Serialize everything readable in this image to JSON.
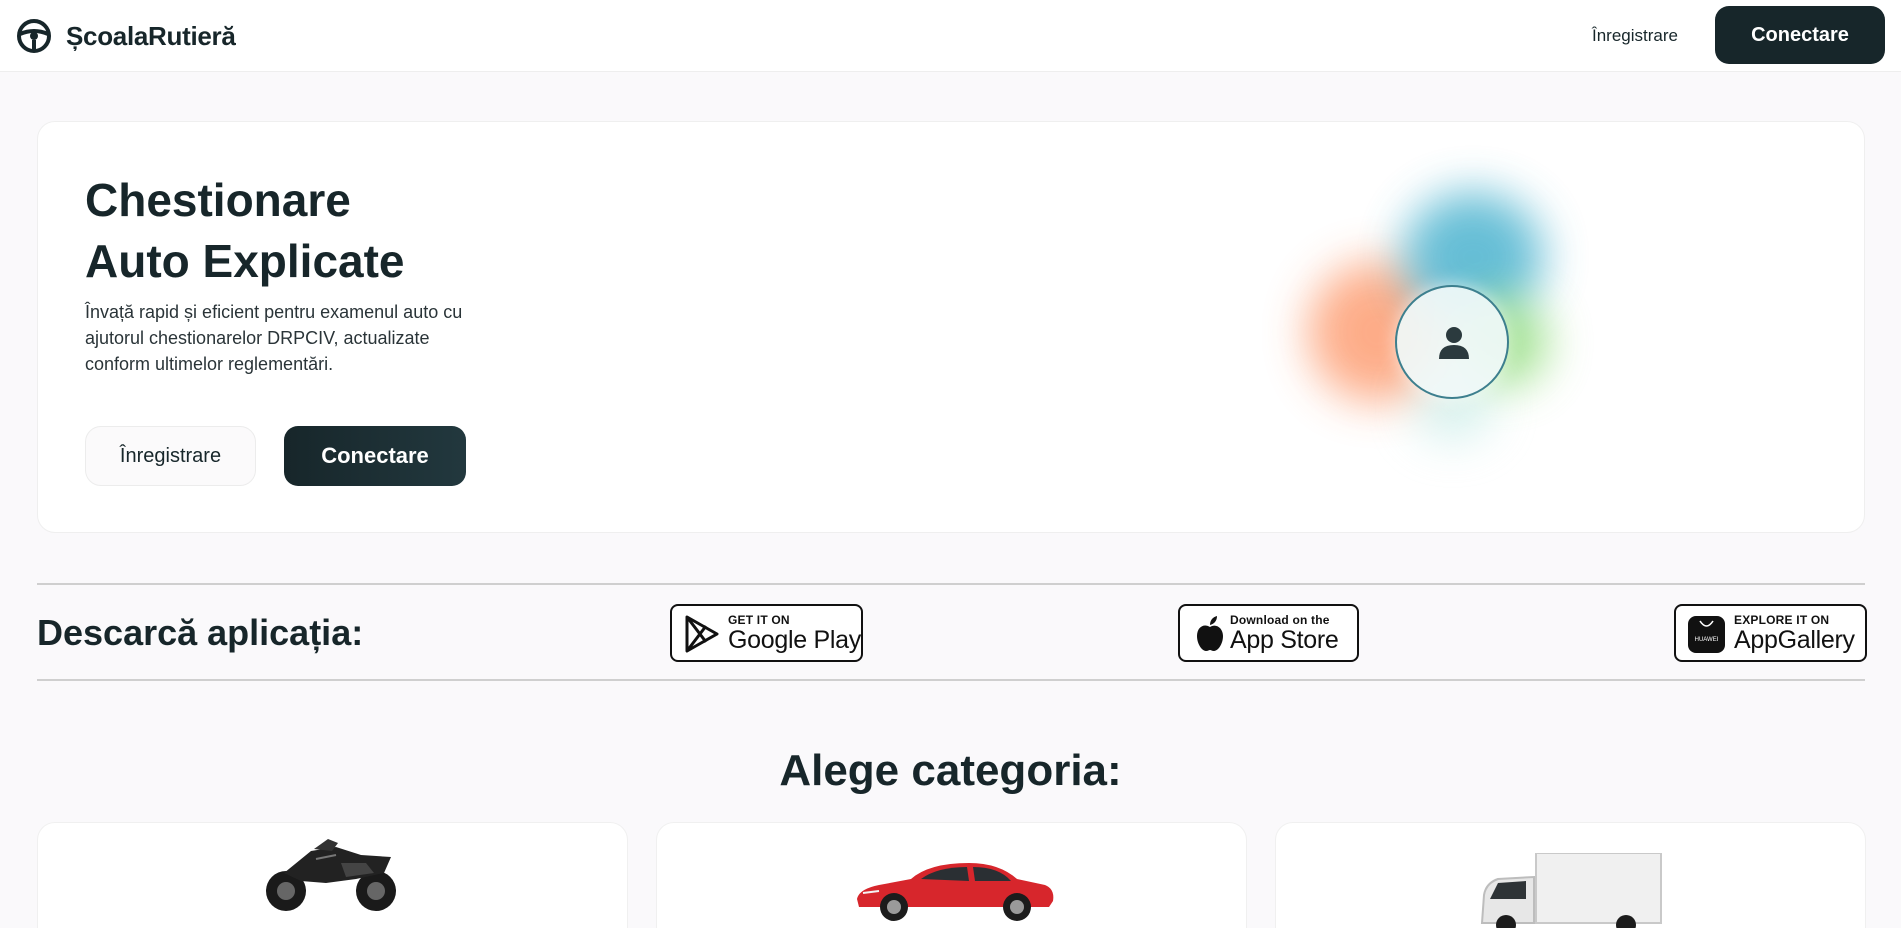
{
  "header": {
    "logo_text": "ȘcoalaRutieră",
    "logo_icon": "steering-wheel-icon",
    "register_label": "Înregistrare",
    "login_label": "Conectare"
  },
  "hero": {
    "title_line1": "Chestionare",
    "title_line2": "Auto Explicate",
    "description": "Învață rapid și eficient pentru examenul auto cu ajutorul chestionarelor DRPCIV, actualizate conform ultimelor reglementări.",
    "register_label": "Înregistrare",
    "login_label": "Conectare",
    "avatar_icon": "user-icon"
  },
  "download": {
    "title": "Descarcă aplicația:",
    "stores": [
      {
        "small": "GET IT ON",
        "big": "Google Play",
        "icon": "google-play-icon"
      },
      {
        "small": "Download on the",
        "big": "App Store",
        "icon": "apple-icon"
      },
      {
        "small": "EXPLORE IT ON",
        "big": "AppGallery",
        "icon": "huawei-appgallery-icon",
        "icon_label": "HUAWEI"
      }
    ]
  },
  "categories": {
    "title": "Alege categoria:",
    "items": [
      {
        "icon": "motorcycle-image"
      },
      {
        "icon": "car-image"
      },
      {
        "icon": "truck-image"
      }
    ]
  },
  "colors": {
    "primary_dark": "#17262a",
    "background": "#faf9fb",
    "card": "#ffffff"
  }
}
